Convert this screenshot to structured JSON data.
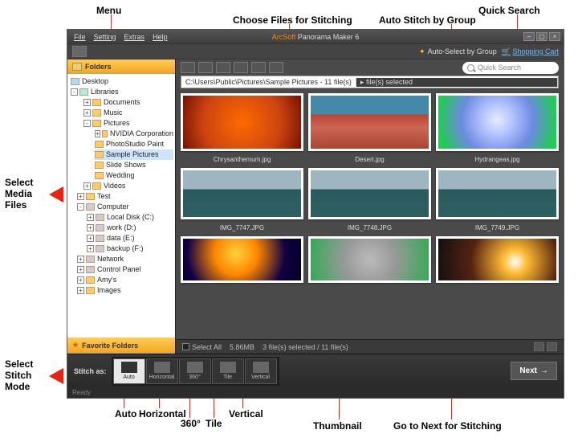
{
  "annotations": {
    "menu": "Menu",
    "choose_files": "Choose Files for Stitching",
    "auto_stitch": "Auto Stitch by Group",
    "quick_search": "Quick Search",
    "select_media": "Select\nMedia\nFiles",
    "select_stitch": "Select\nStitch\nMode",
    "auto": "Auto",
    "horizontal": "Horizontal",
    "deg360": "360°",
    "tile": "Tile",
    "vertical": "Vertical",
    "thumbnail": "Thumbnail",
    "go_next": "Go to Next for Stitching"
  },
  "title_brand": "ArcSoft",
  "title_rest": " Panorama Maker 6",
  "menu": {
    "file": "File",
    "setting": "Setting",
    "extras": "Extras",
    "help": "Help"
  },
  "subbar": {
    "auto_select": "Auto-Select by Group",
    "cart": "Shopping Cart"
  },
  "folders_header": "Folders",
  "favorites_header": "Favorite Folders",
  "tree": {
    "desktop": "Desktop",
    "libraries": "Libraries",
    "documents": "Documents",
    "music": "Music",
    "pictures": "Pictures",
    "nvidia": "NVIDIA Corporation",
    "psp": "PhotoStudio Paint",
    "sample": "Sample Pictures",
    "slides": "Slide Shows",
    "wedding": "Wedding",
    "videos": "Videos",
    "test": "Test",
    "computer": "Computer",
    "localc": "Local Disk (C:)",
    "workd": "work (D:)",
    "datae": "data (E:)",
    "backupf": "backup (F:)",
    "network": "Network",
    "cpanel": "Control Panel",
    "amys": "Amy's",
    "images": "Images"
  },
  "path": {
    "seg1": "C:\\Users\\Public\\Pictures\\Sample Pictures - 11 file(s)",
    "seg2": "file(s) selected"
  },
  "search_placeholder": "Quick Search",
  "thumbs": {
    "r1": [
      {
        "cap": "Chrysanthemum.jpg"
      },
      {
        "cap": "Desert.jpg"
      },
      {
        "cap": "Hydrangeas.jpg"
      }
    ],
    "r2": [
      {
        "cap": "IMG_7747.JPG"
      },
      {
        "cap": "IMG_7748.JPG"
      },
      {
        "cap": "IMG_7749.JPG"
      }
    ],
    "r3": [
      {
        "cap": ""
      },
      {
        "cap": ""
      },
      {
        "cap": ""
      }
    ]
  },
  "status": {
    "select_all": "Select All",
    "size": "5.86MB",
    "count": "3 file(s) selected / 11 file(s)"
  },
  "stitch": {
    "label": "Stitch as:",
    "modes": {
      "auto": "Auto",
      "horizontal": "Horizontal",
      "deg360": "360°",
      "tile": "Tile",
      "vertical": "Vertical"
    },
    "next": "Next"
  },
  "footer_status": "Ready"
}
